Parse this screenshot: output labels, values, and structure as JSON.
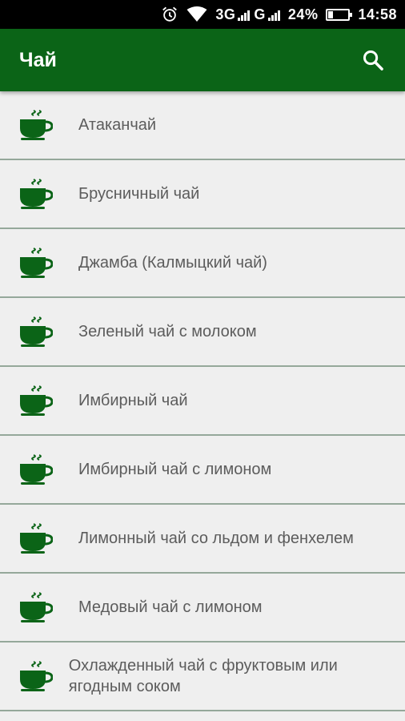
{
  "status_bar": {
    "network_1": "3G",
    "network_2": "G",
    "battery": "24%",
    "battery_level": 0.24,
    "time": "14:58",
    "icons": [
      "alarm-icon",
      "wifi-icon",
      "signal-icon",
      "battery-icon"
    ]
  },
  "app_bar": {
    "title": "Чай",
    "search_icon": "search-icon"
  },
  "colors": {
    "primary": "#0b6417",
    "status_bar": "#000000",
    "background": "#efefef",
    "text": "#5c5c5c",
    "icon": "#0b6417",
    "divider": "#95a89a"
  },
  "list": {
    "item_icon": "tea-cup-icon",
    "items": [
      {
        "label": "Атаканчай"
      },
      {
        "label": "Брусничный чай"
      },
      {
        "label": "Джамба (Калмыцкий чай)"
      },
      {
        "label": "Зеленый чай с молоком"
      },
      {
        "label": "Имбирный чай"
      },
      {
        "label": "Имбирный чай с лимоном"
      },
      {
        "label": "Лимонный чай со льдом и фенхелем"
      },
      {
        "label": "Медовый чай с лимоном"
      },
      {
        "label": "Охлажденный чай с фруктовым или ягодным соком"
      }
    ]
  }
}
